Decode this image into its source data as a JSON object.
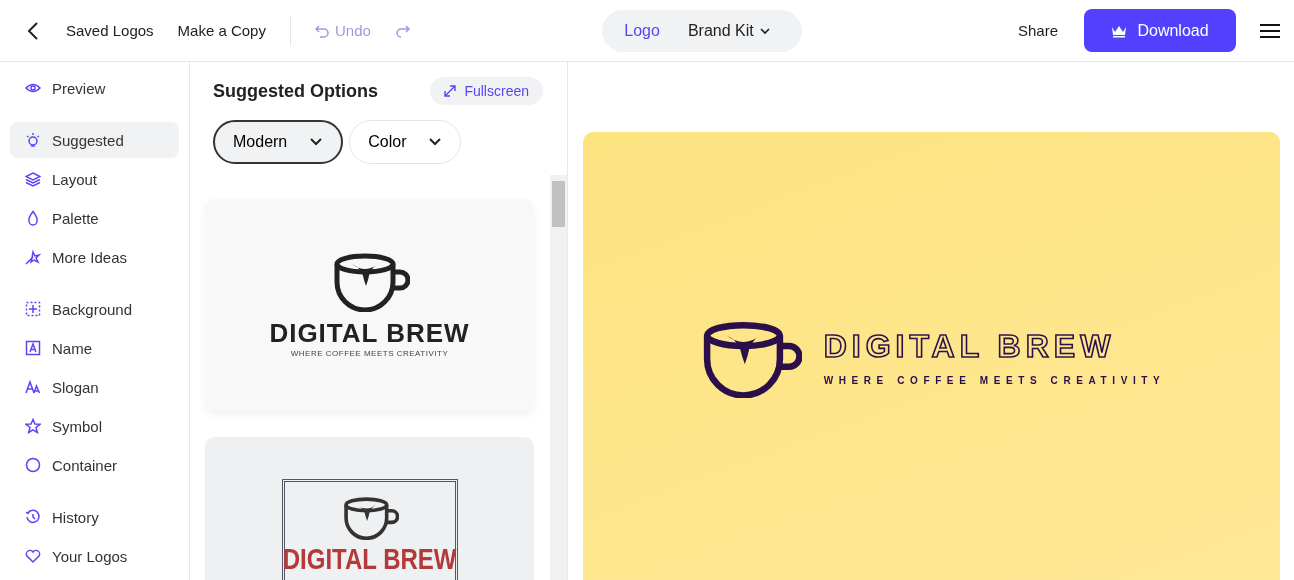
{
  "toolbar": {
    "links": [
      "Saved Logos",
      "Make a Copy"
    ],
    "undo": {
      "label": "Undo",
      "disabled": true
    },
    "redo": {
      "disabled": true
    },
    "mode_tabs": [
      {
        "label": "Logo",
        "selected": true,
        "dropdown": false
      },
      {
        "label": "Brand Kit",
        "selected": false,
        "dropdown": true
      }
    ],
    "share": "Share",
    "download": "Download"
  },
  "sidebar": {
    "groups": [
      [
        {
          "label": "Preview",
          "kind": "eye",
          "selected": false
        }
      ],
      [
        {
          "label": "Suggested",
          "kind": "bulb",
          "selected": true
        },
        {
          "label": "Layout",
          "kind": "layers",
          "selected": false
        },
        {
          "label": "Palette",
          "kind": "drop",
          "selected": false
        },
        {
          "label": "More Ideas",
          "kind": "wand",
          "selected": false
        }
      ],
      [
        {
          "label": "Background",
          "kind": "grid",
          "selected": false
        },
        {
          "label": "Name",
          "kind": "letter",
          "selected": false
        },
        {
          "label": "Slogan",
          "kind": "font",
          "selected": false
        },
        {
          "label": "Symbol",
          "kind": "star",
          "selected": false
        },
        {
          "label": "Container",
          "kind": "circle",
          "selected": false
        }
      ],
      [
        {
          "label": "History",
          "kind": "history",
          "selected": false
        },
        {
          "label": "Your Logos",
          "kind": "heart",
          "selected": false
        }
      ]
    ]
  },
  "panel": {
    "title": "Suggested Options",
    "fullscreen": "Fullscreen",
    "filters": [
      {
        "label": "Modern",
        "selected": true
      },
      {
        "label": "Color",
        "selected": false
      }
    ],
    "cards": [
      {
        "kind": "modern",
        "name": "DIGITAL BREW",
        "slogan": "WHERE COFFEE MEETS CREATIVITY"
      },
      {
        "kind": "framed",
        "name": "DIGITAL BREW"
      }
    ]
  },
  "preview": {
    "name": "DIGITAL BREW",
    "slogan": "WHERE COFFEE MEETS CREATIVITY"
  }
}
